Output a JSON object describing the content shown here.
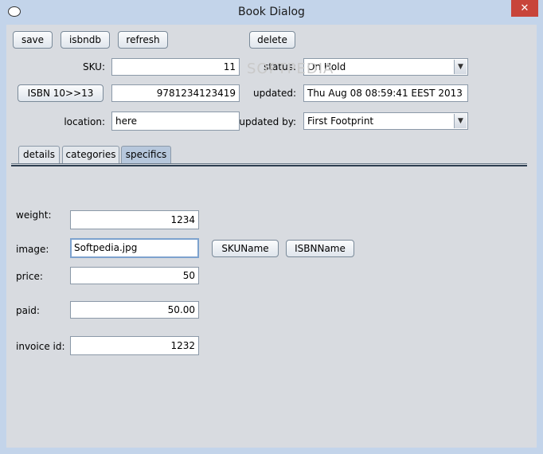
{
  "window": {
    "title": "Book Dialog",
    "close_glyph": "✕"
  },
  "toolbar": {
    "save": "save",
    "isbndb": "isbndb",
    "refresh": "refresh",
    "delete": "delete",
    "isbn_convert": "ISBN 10>>13"
  },
  "form": {
    "sku_label": "SKU:",
    "sku_value": "11",
    "isbn_value": "9781234123419",
    "location_label": "location:",
    "location_value": "here",
    "status_label": "status:",
    "status_value": "On Hold",
    "updated_label": "updated:",
    "updated_value": "Thu Aug 08 08:59:41 EEST 2013",
    "updated_by_label": "updated by:",
    "updated_by_value": "First Footprint"
  },
  "tabs": [
    {
      "label": "details",
      "active": false
    },
    {
      "label": "categories",
      "active": false
    },
    {
      "label": "specifics",
      "active": true
    }
  ],
  "specifics": {
    "weight_label": "weight:",
    "weight_value": "1234",
    "image_label": "image:",
    "image_value": "Softpedia.jpg",
    "skuname_button": "SKUName",
    "isbnname_button": "ISBNName",
    "price_label": "price:",
    "price_value": "50",
    "paid_label": "paid:",
    "paid_value": "50.00",
    "invoice_label": "invoice id:",
    "invoice_value": "1232"
  },
  "icons": {
    "app": "app-window-icon",
    "dropdown": "chevron-down-icon"
  },
  "colors": {
    "title_bg": "#c3d4ea",
    "panel_bg": "#d8dbe0",
    "active_tab": "#b6c7dc",
    "close": "#c8443a"
  }
}
